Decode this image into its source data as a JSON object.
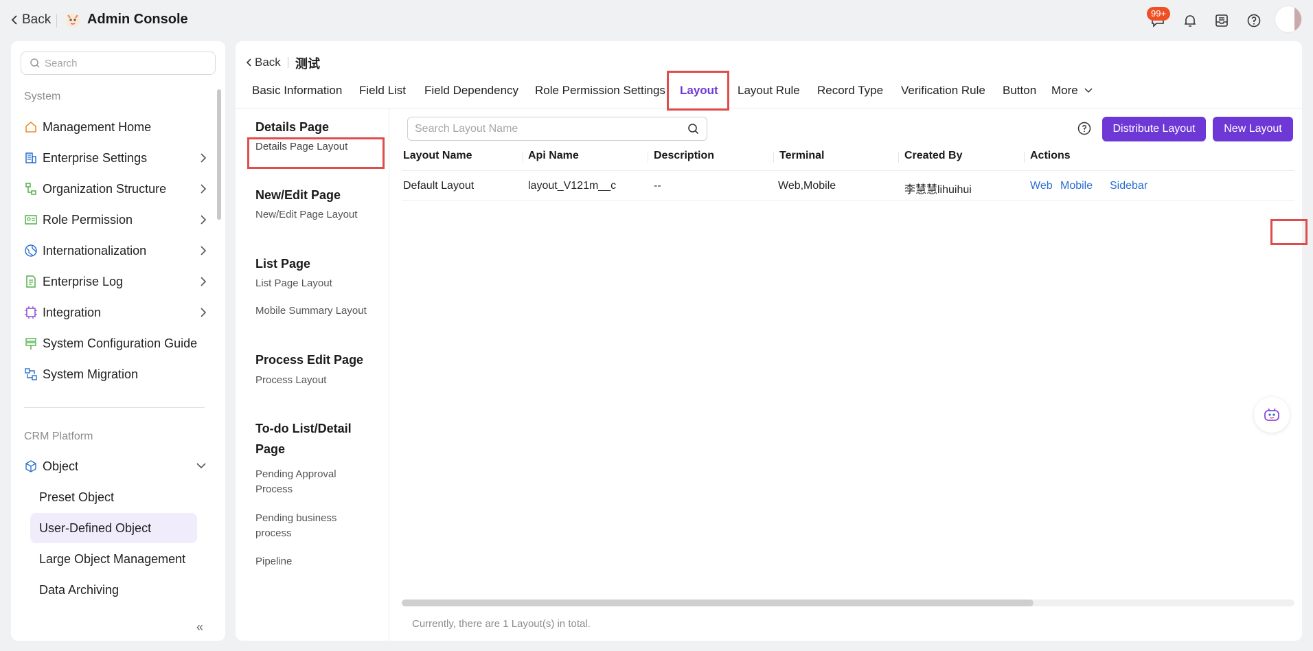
{
  "topbar": {
    "back_label": "Back",
    "title": "Admin Console",
    "notification_badge": "99+"
  },
  "sidebar": {
    "search_placeholder": "Search",
    "section_system": "System",
    "system_items": [
      {
        "label": "Management Home",
        "icon": "home-icon",
        "color": "#f08a24"
      },
      {
        "label": "Enterprise Settings",
        "icon": "building-icon",
        "color": "#2b6fcf"
      },
      {
        "label": "Organization Structure",
        "icon": "org-tree-icon",
        "color": "#52b04a"
      },
      {
        "label": "Role Permission",
        "icon": "id-card-icon",
        "color": "#52b04a"
      },
      {
        "label": "Internationalization",
        "icon": "globe-icon",
        "color": "#2b6fcf"
      },
      {
        "label": "Enterprise Log",
        "icon": "log-icon",
        "color": "#52b04a"
      },
      {
        "label": "Integration",
        "icon": "chip-icon",
        "color": "#8a4bd6"
      },
      {
        "label": "System Configuration Guide",
        "icon": "signpost-icon",
        "color": "#52b04a"
      },
      {
        "label": "System Migration",
        "icon": "migrate-icon",
        "color": "#2b6fcf"
      }
    ],
    "section_crm": "CRM Platform",
    "object_label": "Object",
    "object_subitems": [
      {
        "label": "Preset Object"
      },
      {
        "label": "User-Defined Object"
      },
      {
        "label": "Large Object Management"
      },
      {
        "label": "Data Archiving"
      }
    ],
    "collapse_icon": "«"
  },
  "main": {
    "back_label": "Back",
    "object_title": "测试",
    "tabs": [
      {
        "label": "Basic Information"
      },
      {
        "label": "Field List"
      },
      {
        "label": "Field Dependency"
      },
      {
        "label": "Role Permission Settings"
      },
      {
        "label": "Layout"
      },
      {
        "label": "Layout Rule"
      },
      {
        "label": "Record Type"
      },
      {
        "label": "Verification Rule"
      },
      {
        "label": "Button"
      },
      {
        "label": "More"
      }
    ],
    "layout_nav": {
      "details_head": "Details Page",
      "details_item": "Details Page Layout",
      "newedit_head": "New/Edit Page",
      "newedit_item": "New/Edit Page Layout",
      "list_head": "List Page",
      "list_item1": "List Page Layout",
      "list_item2": "Mobile Summary Layout",
      "process_head": "Process Edit Page",
      "process_item": "Process Layout",
      "todo_head_1": "To-do List/Detail",
      "todo_head_2": "Page",
      "todo_item1_a": "Pending Approval",
      "todo_item1_b": "Process",
      "todo_item2_a": "Pending business",
      "todo_item2_b": "process",
      "todo_item3": "Pipeline"
    },
    "search_placeholder": "Search Layout Name",
    "distribute_button": "Distribute Layout",
    "new_button": "New Layout",
    "table": {
      "headers": [
        "Layout Name",
        "Api Name",
        "Description",
        "Terminal",
        "Created By",
        "Actions"
      ],
      "rows": [
        {
          "layout_name": "Default Layout",
          "api_name": "layout_V121m__c",
          "description": "--",
          "terminal": "Web,Mobile",
          "created_by": "李慧慧lihuihui",
          "actions": [
            "Web",
            "Mobile",
            "Sidebar"
          ]
        }
      ]
    },
    "footer": "Currently, there are 1 Layout(s) in total."
  },
  "colors": {
    "accent": "#6e38d6",
    "link": "#2b6fcf",
    "highlight_box": "#e04b4b",
    "badge": "#f04e23"
  }
}
